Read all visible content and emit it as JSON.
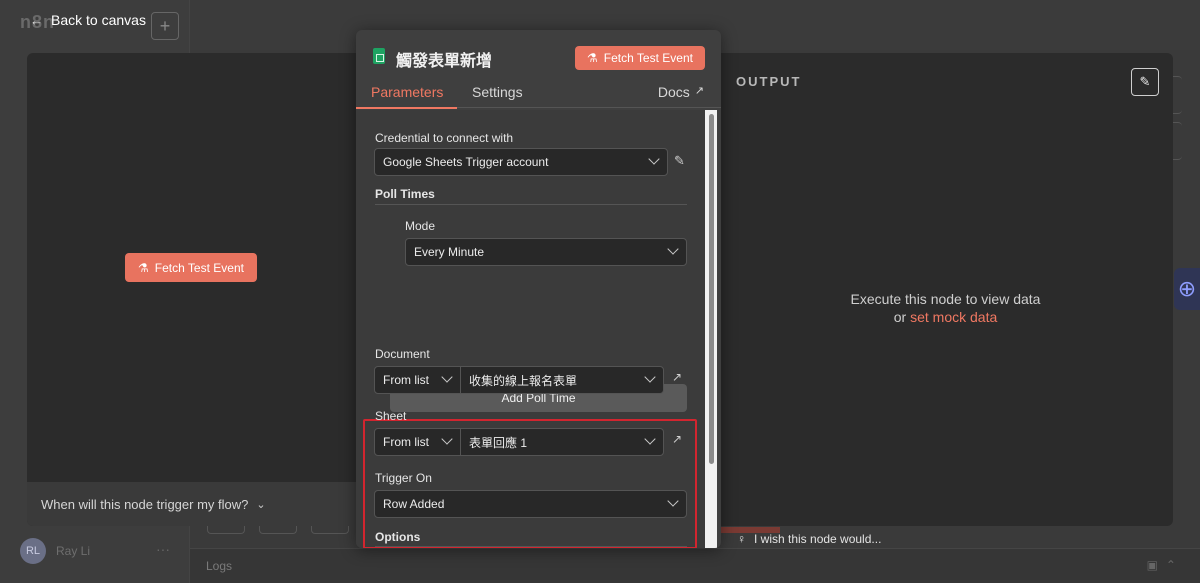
{
  "background": {
    "logo_text": "n8n",
    "plus_label": "+",
    "user": {
      "initials": "RL",
      "name": "Ray Li"
    },
    "more_label": "···",
    "logs_label": "Logs"
  },
  "back_to_canvas": "Back to canvas",
  "input_panel": {
    "fetch_button": "Fetch Test Event",
    "trigger_question": "When will this node trigger my flow?"
  },
  "dialog": {
    "title": "觸發表單新增",
    "fetch_button": "Fetch Test Event",
    "tabs": {
      "parameters": "Parameters",
      "settings": "Settings",
      "docs": "Docs"
    },
    "credential": {
      "label": "Credential to connect with",
      "value": "Google Sheets Trigger account"
    },
    "poll_times": {
      "label": "Poll Times",
      "mode_label": "Mode",
      "mode_value": "Every Minute",
      "add_button": "Add Poll Time"
    },
    "document": {
      "label": "Document",
      "mode": "From list",
      "value": "收集的線上報名表單"
    },
    "sheet": {
      "label": "Sheet",
      "mode": "From list",
      "value": "表單回應 1"
    },
    "trigger_on": {
      "label": "Trigger On",
      "value": "Row Added"
    },
    "options": {
      "label": "Options"
    }
  },
  "output_panel": {
    "title": "OUTPUT",
    "message_line1": "Execute this node to view data",
    "message_or": "or",
    "mock_link": "set mock data"
  },
  "wish_text": "I wish this node would...",
  "colors": {
    "accent": "#e8735f",
    "highlight_box": "#d2252f",
    "sheets_green": "#1ea362"
  }
}
